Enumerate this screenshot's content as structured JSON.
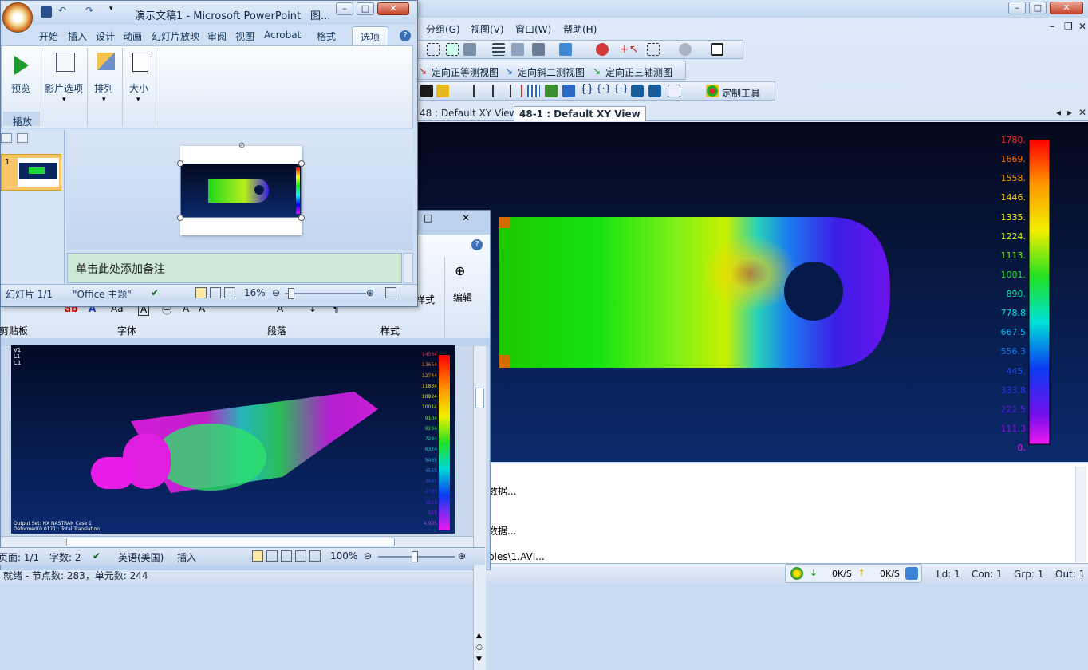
{
  "femap": {
    "menu": [
      "分组(G)",
      "视图(V)",
      "窗口(W)",
      "帮助(H)"
    ],
    "toolbar": {
      "iso_view": "定向正等测视图",
      "dimetric_view": "定向斜二测视图",
      "trimetric_view": "定向正三轴测图",
      "custom_tools": "定制工具"
    },
    "view_tabs": [
      "48 : Default XY View",
      "48-1 : Default XY View"
    ],
    "legend": [
      "1780.",
      "1669.",
      "1558.",
      "1446.",
      "1335.",
      "1224.",
      "1113.",
      "1001.",
      "890.",
      "778.8",
      "667.5",
      "556.3",
      "445.",
      "333.8",
      "222.5",
      "111.3",
      "0."
    ],
    "messages": [
      "数据...",
      "数据...",
      "ples\\1.AVI..."
    ],
    "status": {
      "left": "就绪 - 节点数: 283，单元数: 244",
      "down_speed": "0K/S",
      "up_speed": "0K/S",
      "ld": "Ld: 1",
      "con": "Con: 1",
      "grp": "Grp: 1",
      "out": "Out: 1"
    },
    "colors": {
      "accent": "#0b2a6c"
    }
  },
  "word": {
    "ribbon": {
      "edit_label": "编辑",
      "style_partial": "样式",
      "groups": [
        "剪贴板",
        "字体",
        "段落",
        "样式"
      ]
    },
    "doc_legend": [
      "14564",
      "13654",
      "12744",
      "11834",
      "10924",
      "10014",
      "9104",
      "8194",
      "7284",
      "6374",
      "5465",
      "4555",
      "3645",
      "2735",
      "1825",
      "915",
      "4.905"
    ],
    "doc_header": [
      "V1",
      "L1",
      "C1"
    ],
    "doc_footer": [
      "Output Set: NX NASTRAN Case 1",
      "Deformed(0.0171): Total Translation"
    ],
    "status": {
      "page": "页面: 1/1",
      "words": "字数: 2",
      "language": "英语(美国)",
      "insert": "插入",
      "zoom": "100%"
    }
  },
  "ppt": {
    "title": "演示文稿1 - Microsoft PowerPoint",
    "title_suffix": "图...",
    "tabs": [
      "开始",
      "插入",
      "设计",
      "动画",
      "幻灯片放映",
      "审阅",
      "视图",
      "Acrobat",
      "格式",
      "选项"
    ],
    "ribbon": {
      "preview": "预览",
      "movie_options": "影片选项",
      "arrange": "排列",
      "size": "大小",
      "group_play": "播放"
    },
    "notes_placeholder": "单击此处添加备注",
    "status": {
      "slide": "幻灯片 1/1",
      "theme": "\"Office 主题\"",
      "zoom": "16%"
    },
    "slide_number": "1"
  }
}
